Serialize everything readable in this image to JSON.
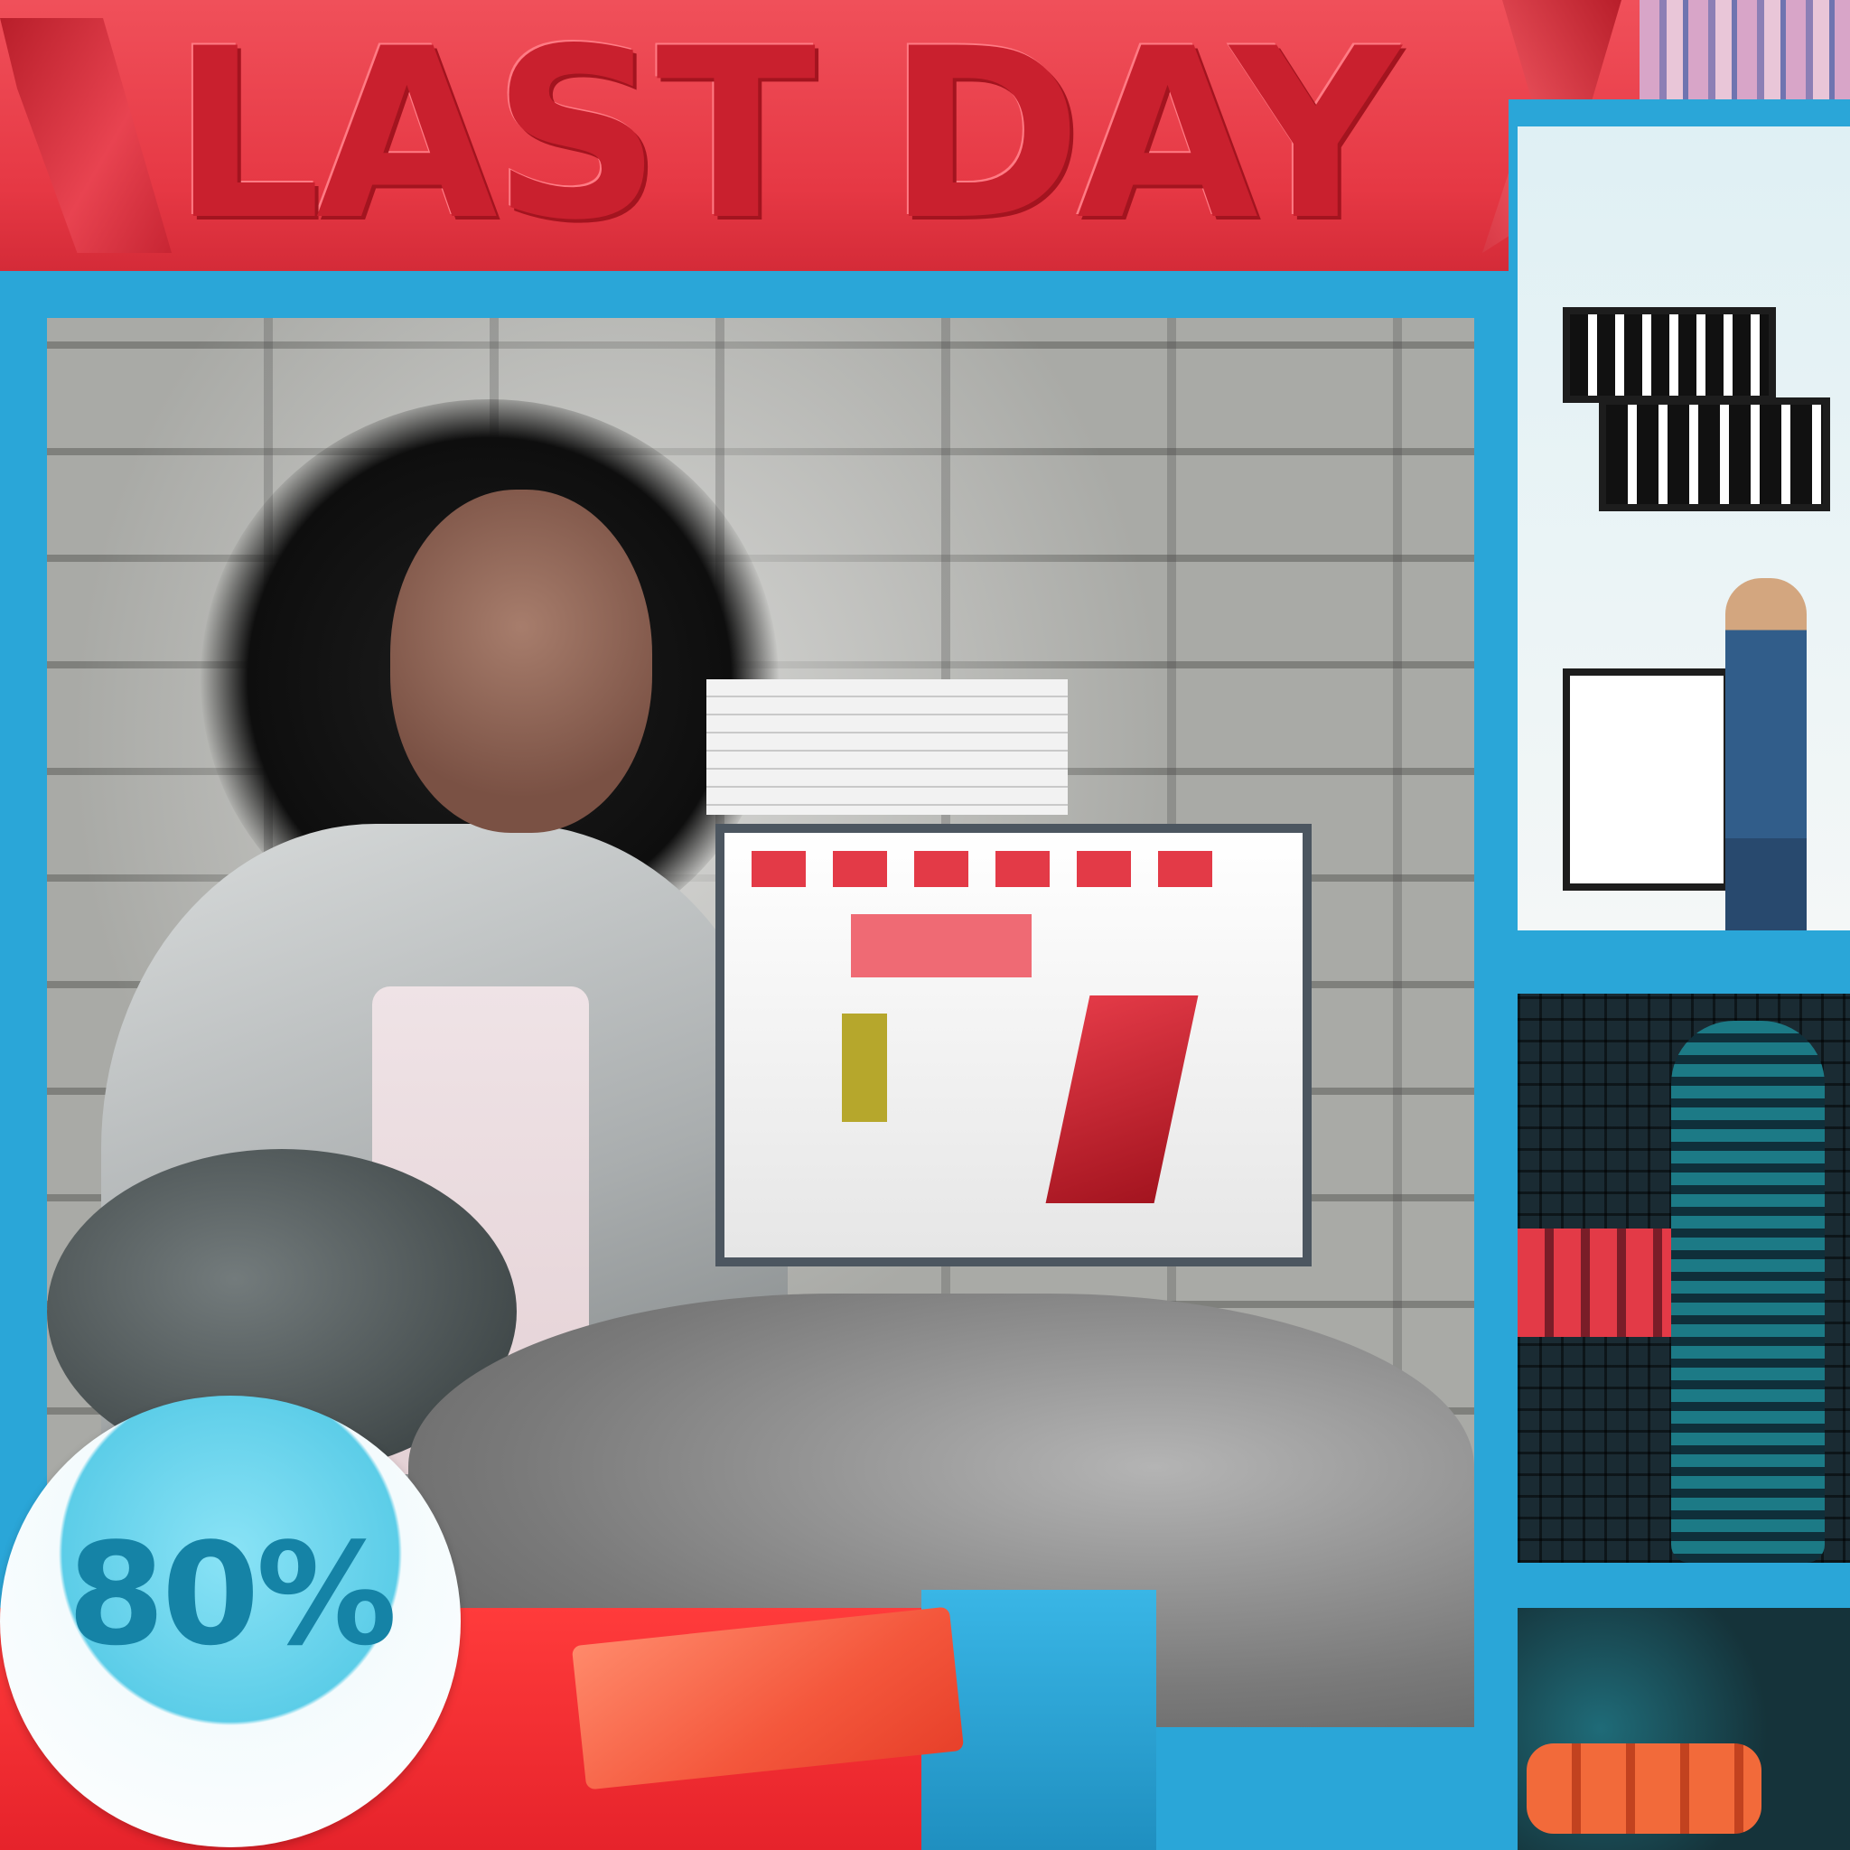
{
  "banner": {
    "headline": "LAST DAY"
  },
  "badge": {
    "discount": "80%"
  },
  "colors": {
    "banner_red": "#e63844",
    "frame_blue": "#2aa6d8",
    "badge_text": "#1583a6",
    "badge_fill": "#5ccde8"
  },
  "icons": {
    "banner_ribbons": "ribbon-decoration"
  }
}
